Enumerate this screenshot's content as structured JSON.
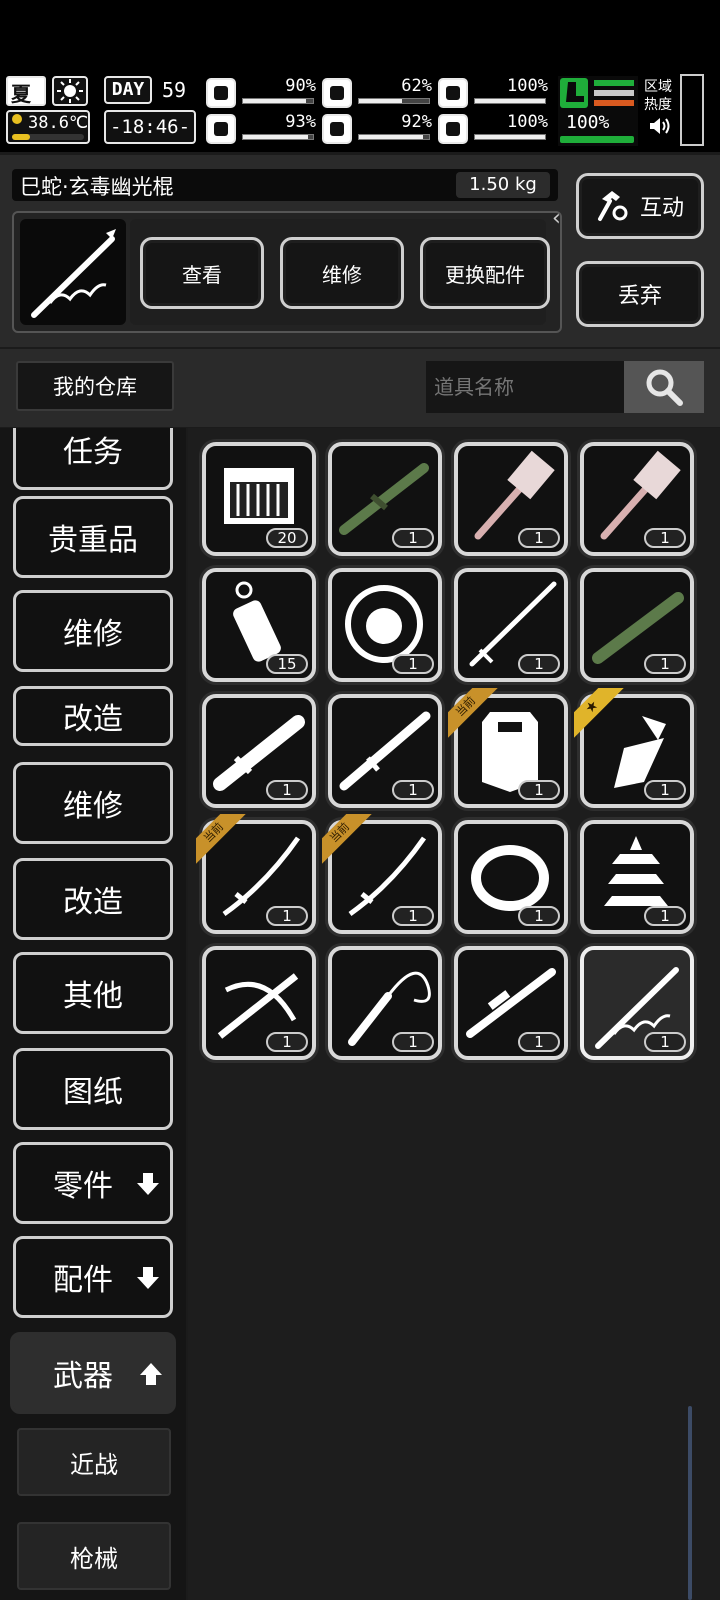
{
  "hud": {
    "season": "夏",
    "temperature": "38.6℃",
    "day_label": "DAY",
    "day_number": "59",
    "clock": "-18:46-",
    "stats": [
      {
        "icon": "medkit-icon",
        "value": "90%",
        "fill": 0.9
      },
      {
        "icon": "stomach-icon",
        "value": "62%",
        "fill": 0.62
      },
      {
        "icon": "battery-icon",
        "value": "100%",
        "fill": 1.0
      },
      {
        "icon": "brain-icon",
        "value": "93%",
        "fill": 0.93
      },
      {
        "icon": "water-drop-icon",
        "value": "92%",
        "fill": 0.92
      },
      {
        "icon": "heart-icon",
        "value": "100%",
        "fill": 1.0
      }
    ],
    "stamina_value": "100%",
    "zone_heat_label": "区域热度"
  },
  "item": {
    "name": "巳蛇·玄毒幽光棍",
    "weight": "1.50 kg",
    "actions": [
      "查看",
      "维修",
      "更换配件"
    ],
    "interact_label": "互动",
    "drop_label": "丢弃"
  },
  "storage": {
    "tab_label": "我的仓库",
    "search_placeholder": "道具名称"
  },
  "sidebar": {
    "categories": [
      {
        "label": "任务",
        "arrow": ""
      },
      {
        "label": "贵重品",
        "arrow": ""
      },
      {
        "label": "维修",
        "arrow": ""
      },
      {
        "label": "改造",
        "arrow": ""
      },
      {
        "label": "维修",
        "arrow": ""
      },
      {
        "label": "改造",
        "arrow": ""
      },
      {
        "label": "其他",
        "arrow": ""
      },
      {
        "label": "图纸",
        "arrow": ""
      },
      {
        "label": "零件",
        "arrow": "down"
      },
      {
        "label": "配件",
        "arrow": "down"
      },
      {
        "label": "武器",
        "arrow": "up"
      }
    ],
    "subcategories": [
      "近战",
      "枪械"
    ]
  },
  "items": [
    {
      "icon": "ammo-crate-icon",
      "count": "20",
      "tag": ""
    },
    {
      "icon": "camo-sniper-rifle-icon",
      "count": "1",
      "tag": ""
    },
    {
      "icon": "war-hammer-icon",
      "count": "1",
      "tag": ""
    },
    {
      "icon": "war-hammer-icon",
      "count": "1",
      "tag": ""
    },
    {
      "icon": "grenade-icon",
      "count": "15",
      "tag": ""
    },
    {
      "icon": "medusa-head-icon",
      "count": "1",
      "tag": ""
    },
    {
      "icon": "katana-icon",
      "count": "1",
      "tag": ""
    },
    {
      "icon": "camo-rocket-launcher-icon",
      "count": "1",
      "tag": ""
    },
    {
      "icon": "ornate-launcher-icon",
      "count": "1",
      "tag": ""
    },
    {
      "icon": "ornate-rifle-icon",
      "count": "1",
      "tag": ""
    },
    {
      "icon": "riot-shield-icon",
      "count": "1",
      "tag": "当前"
    },
    {
      "icon": "axe-icon",
      "count": "1",
      "tag": "star"
    },
    {
      "icon": "twin-blades-icon",
      "count": "1",
      "tag": "当前"
    },
    {
      "icon": "twin-blades-icon",
      "count": "1",
      "tag": "当前"
    },
    {
      "icon": "ornate-ring-icon",
      "count": "1",
      "tag": ""
    },
    {
      "icon": "pagoda-icon",
      "count": "1",
      "tag": ""
    },
    {
      "icon": "crossbow-icon",
      "count": "1",
      "tag": ""
    },
    {
      "icon": "whip-icon",
      "count": "1",
      "tag": ""
    },
    {
      "icon": "ornate-sniper-icon",
      "count": "1",
      "tag": ""
    },
    {
      "icon": "serpent-staff-icon",
      "count": "1",
      "tag": "",
      "selected": true
    }
  ]
}
